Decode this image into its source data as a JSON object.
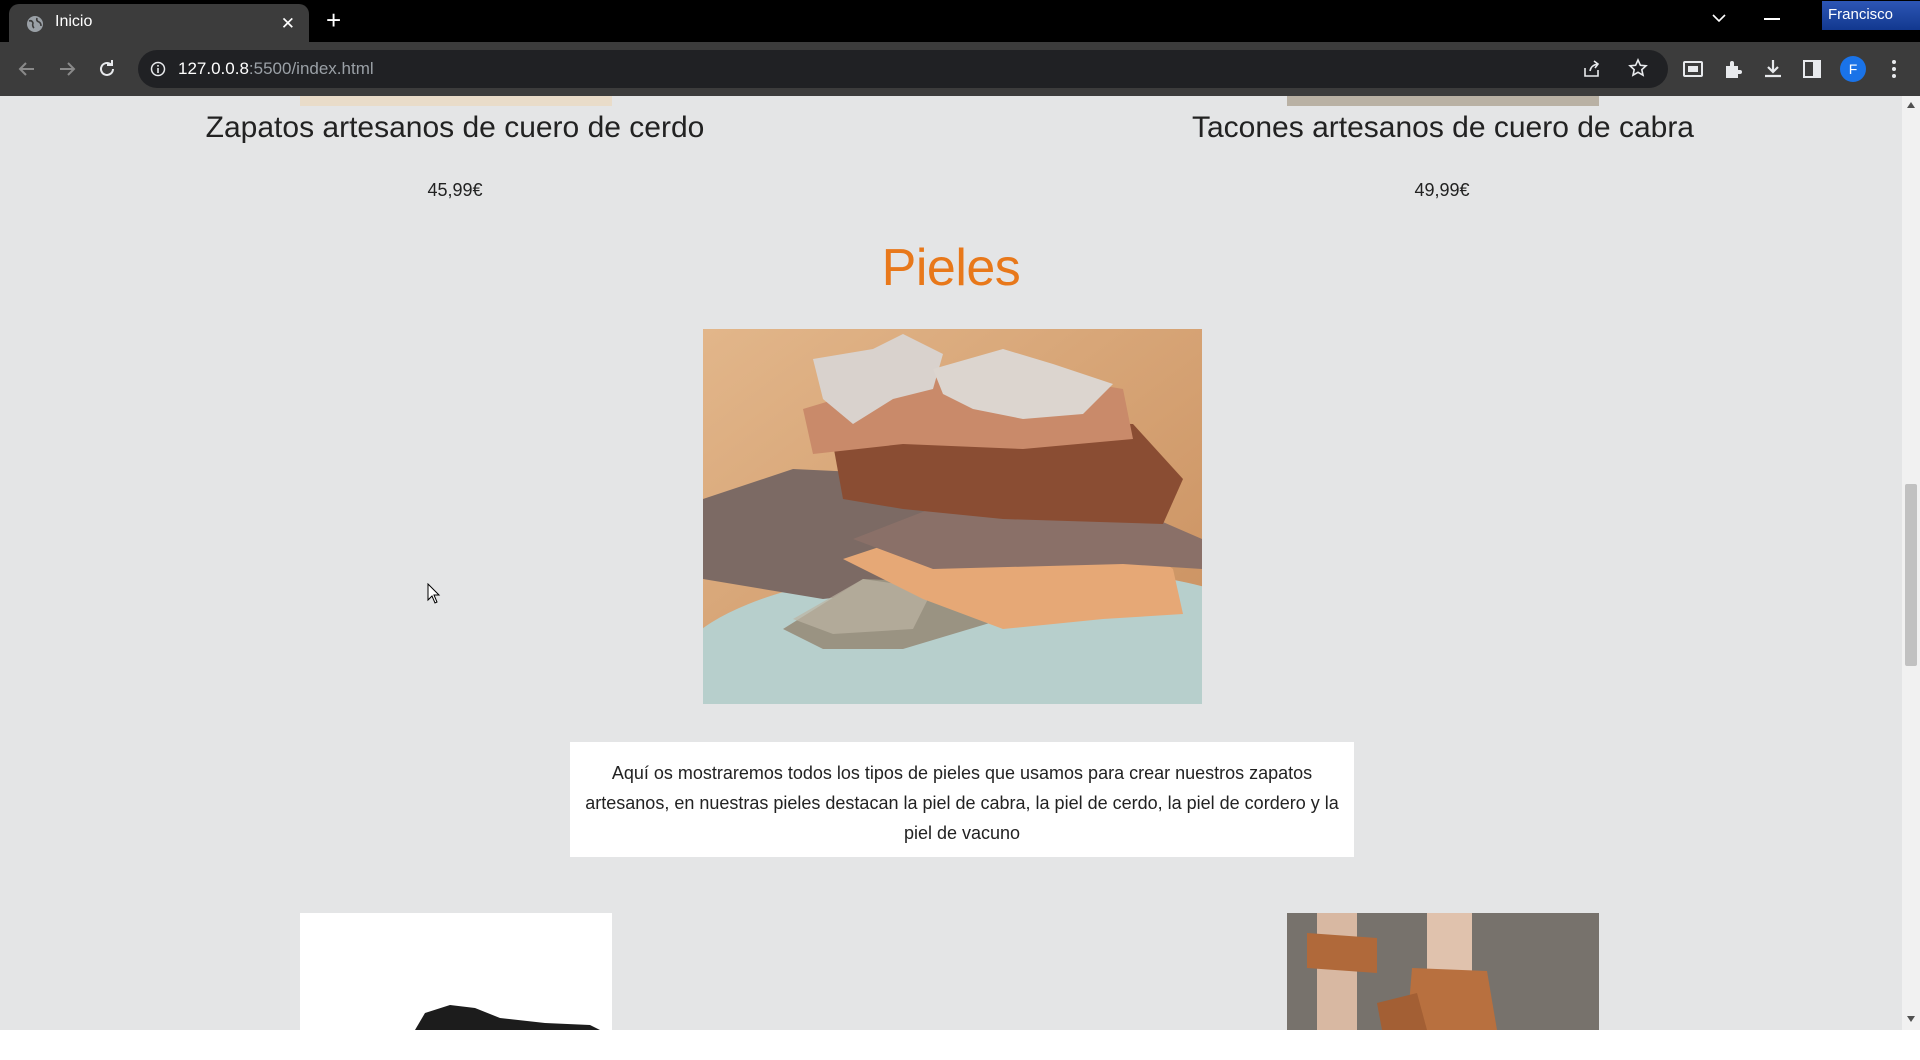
{
  "browser": {
    "tab_title": "Inicio",
    "url_host": "127.0.0.8",
    "url_rest": ":5500/index.html",
    "profile_name": "Francisco",
    "profile_initial": "F"
  },
  "products_top": [
    {
      "name": "Zapatos artesanos de cuero de cerdo",
      "price": "45,99€"
    },
    {
      "name": "Tacones artesanos de cuero de cabra",
      "price": "49,99€"
    }
  ],
  "section": {
    "title": "Pieles",
    "description": "Aquí os mostraremos todos los tipos de pieles que usamos para crear nuestros zapatos artesanos, en nuestras pieles destacan la piel de cabra, la piel de cerdo, la piel de cordero y la piel de vacuno"
  },
  "colors": {
    "accent": "#e8781a",
    "page_background": "#e4e5e6"
  },
  "icons": [
    "globe-icon",
    "close-icon",
    "plus-icon",
    "chevron-down-icon",
    "minimize-icon",
    "back-icon",
    "forward-icon",
    "reload-icon",
    "info-icon",
    "share-icon",
    "star-icon",
    "media-icon",
    "extensions-icon",
    "download-icon",
    "sidepanel-icon",
    "menu-icon",
    "cursor-icon"
  ]
}
